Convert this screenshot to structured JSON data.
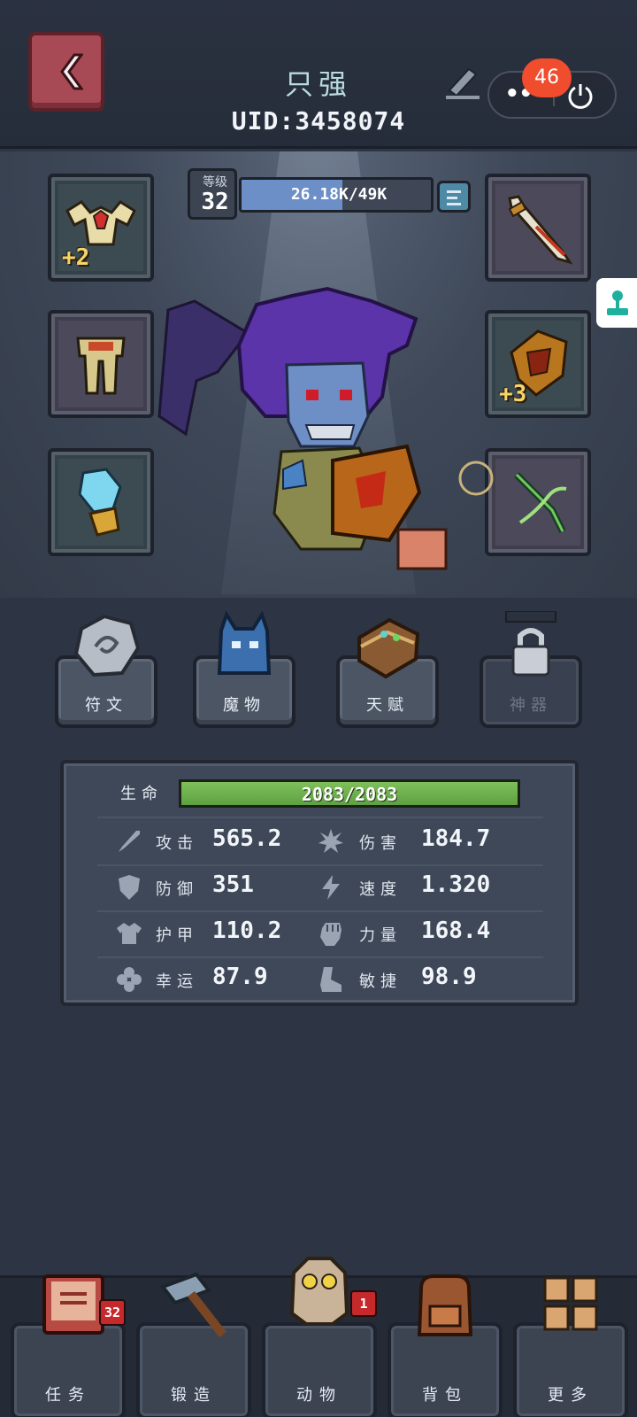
{
  "header": {
    "player_name": "只强",
    "uid": "UID:3458074",
    "notification_count": "46",
    "more_label": "•••"
  },
  "level": {
    "label": "等级",
    "value": "32",
    "xp_text": "26.18K/49K",
    "xp_fraction": 0.534
  },
  "equipment": {
    "left": [
      {
        "name": "shoulder-armor",
        "plus": "+2"
      },
      {
        "name": "leg-armor",
        "plus": ""
      },
      {
        "name": "crystal-gauntlet",
        "plus": ""
      }
    ],
    "right": [
      {
        "name": "sword",
        "plus": ""
      },
      {
        "name": "helmet",
        "plus": "+3"
      },
      {
        "name": "crossbow",
        "plus": ""
      }
    ]
  },
  "tabs": [
    {
      "label": "符文",
      "locked": false
    },
    {
      "label": "魔物",
      "locked": false
    },
    {
      "label": "天赋",
      "locked": false
    },
    {
      "label": "神器",
      "locked": true
    }
  ],
  "stats": {
    "hp_label": "生命",
    "hp_text": "2083/2083",
    "hp_fraction": 1.0,
    "rows": [
      {
        "left_icon": "sword-icon",
        "left_name": "攻击",
        "left_value": "565.2",
        "right_icon": "burst-icon",
        "right_name": "伤害",
        "right_value": "184.7"
      },
      {
        "left_icon": "shield-icon",
        "left_name": "防御",
        "left_value": "351",
        "right_icon": "lightning-icon",
        "right_name": "速度",
        "right_value": "1.320"
      },
      {
        "left_icon": "armor-icon",
        "left_name": "护甲",
        "left_value": "110.2",
        "right_icon": "fist-icon",
        "right_name": "力量",
        "right_value": "168.4"
      },
      {
        "left_icon": "clover-icon",
        "left_name": "幸运",
        "left_value": "87.9",
        "right_icon": "boot-icon",
        "right_name": "敏捷",
        "right_value": "98.9"
      }
    ]
  },
  "bottom_nav": [
    {
      "label": "任务",
      "badge": "32"
    },
    {
      "label": "锻造",
      "badge": ""
    },
    {
      "label": "动物",
      "badge": "1"
    },
    {
      "label": "背包",
      "badge": ""
    },
    {
      "label": "更多",
      "badge": ""
    }
  ],
  "colors": {
    "background": "#2d3544",
    "hp_bar": "#5ea142",
    "xp_bar": "#6d8fc8",
    "badge": "#c6292c",
    "notification": "#f04c2e"
  }
}
